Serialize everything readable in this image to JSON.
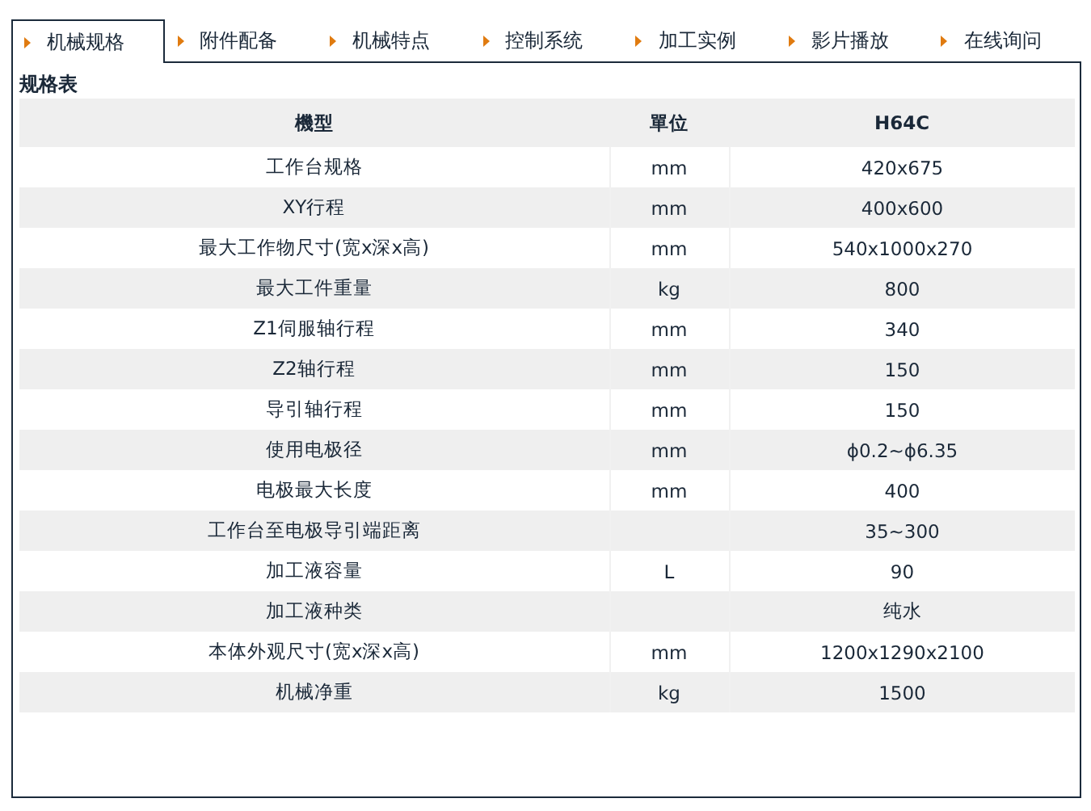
{
  "tabs": [
    {
      "label": "机械规格",
      "selected": true
    },
    {
      "label": "附件配备",
      "selected": false
    },
    {
      "label": "机械特点",
      "selected": false
    },
    {
      "label": "控制系统",
      "selected": false
    },
    {
      "label": "加工实例",
      "selected": false
    },
    {
      "label": "影片播放",
      "selected": false
    },
    {
      "label": "在线询问",
      "selected": false
    }
  ],
  "section_title": "规格表",
  "table": {
    "columns": [
      "機型",
      "單位",
      "H64C"
    ],
    "rows": [
      [
        "工作台规格",
        "mm",
        "420x675"
      ],
      [
        "XY行程",
        "mm",
        "400x600"
      ],
      [
        "最大工作物尺寸(宽x深x高)",
        "mm",
        "540x1000x270"
      ],
      [
        "最大工件重量",
        "kg",
        "800"
      ],
      [
        "Z1伺服轴行程",
        "mm",
        "340"
      ],
      [
        "Z2轴行程",
        "mm",
        "150"
      ],
      [
        "导引轴行程",
        "mm",
        "150"
      ],
      [
        "使用电极径",
        "mm",
        "ϕ0.2~ϕ6.35"
      ],
      [
        "电极最大长度",
        "mm",
        "400"
      ],
      [
        "工作台至电极导引端距离",
        "",
        "35~300"
      ],
      [
        "加工液容量",
        "L",
        "90"
      ],
      [
        "加工液种类",
        "",
        "纯水"
      ],
      [
        "本体外观尺寸(宽x深x高)",
        "mm",
        "1200x1290x2100"
      ],
      [
        "机械净重",
        "kg",
        "1500"
      ]
    ]
  }
}
